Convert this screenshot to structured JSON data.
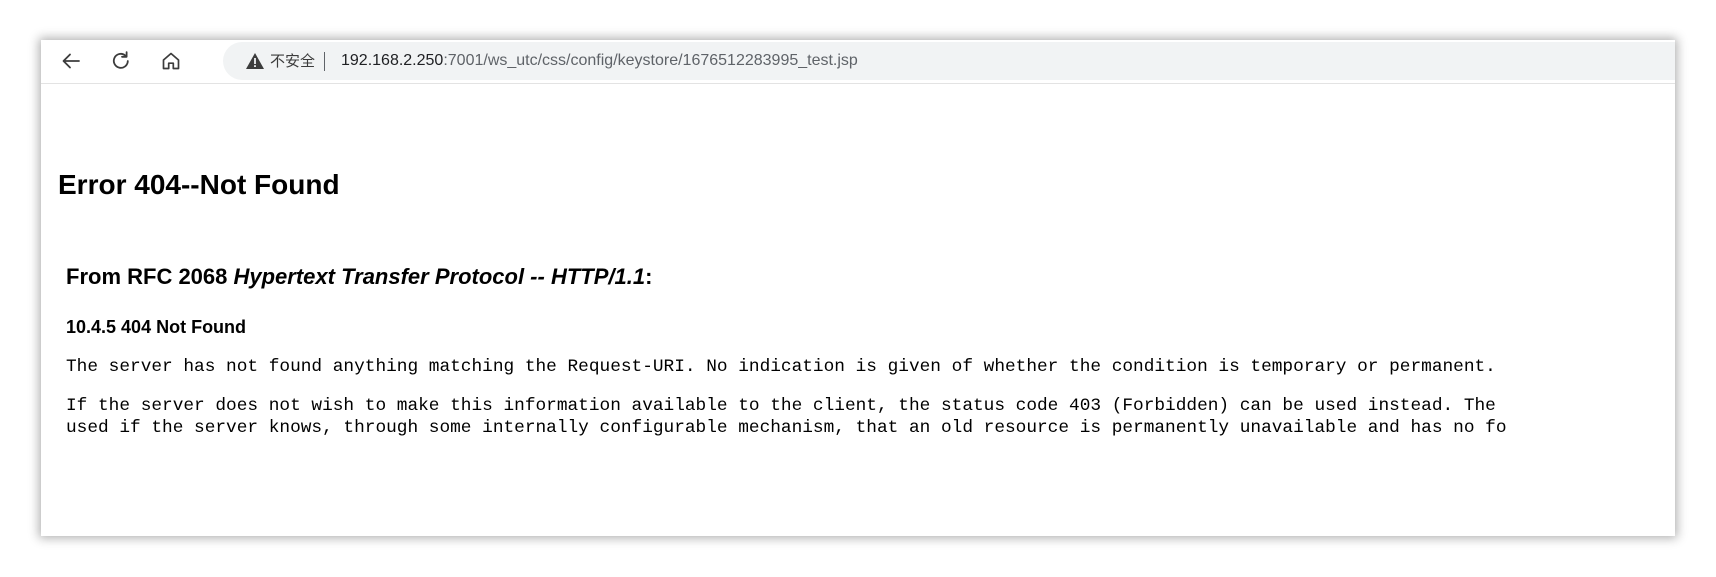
{
  "browser": {
    "back_icon": "arrow-left-icon",
    "reload_icon": "reload-icon",
    "home_icon": "home-icon",
    "security_icon": "warning-triangle-icon",
    "security_label": "不安全",
    "url_host": "192.168.2.250",
    "url_path": ":7001/ws_utc/css/config/keystore/1676512283995_test.jsp"
  },
  "page": {
    "title": "Error 404--Not Found",
    "rfc_prefix": "From RFC 2068 ",
    "rfc_title": "Hypertext Transfer Protocol -- HTTP/1.1",
    "rfc_suffix": ":",
    "section_heading": "10.4.5 404 Not Found",
    "paragraph1": "The server has not found anything matching the Request-URI. No indication is given of whether the condition is temporary or permanent.",
    "paragraph2_line1": "If the server does not wish to make this information available to the client, the status code 403 (Forbidden) can be used instead. The",
    "paragraph2_line2": "used if the server knows, through some internally configurable mechanism, that an old resource is permanently unavailable and has no fo"
  },
  "colors": {
    "toolbar_bg": "#ffffff",
    "address_bar_bg": "#f1f3f4",
    "url_host": "#202124",
    "url_path": "#5f6368",
    "icon": "#3c3c3c"
  }
}
